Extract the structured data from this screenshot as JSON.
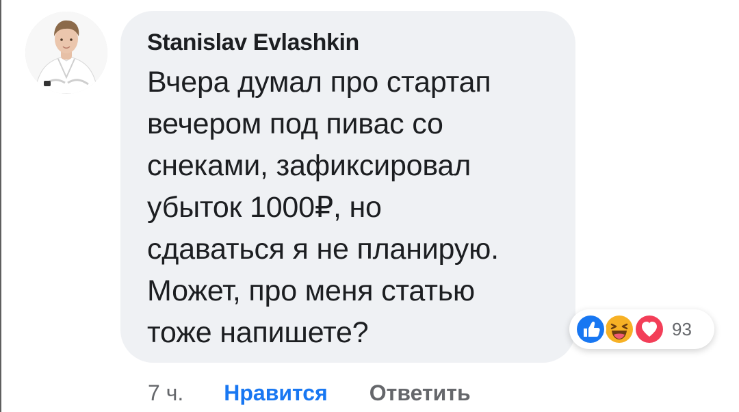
{
  "comment": {
    "author": "Stanislav Evlashkin",
    "text_lines": [
      "Вчера думал про стартап",
      "вечером под пивас со",
      "снеками, зафиксировал",
      "убыток 1000₽, но",
      "сдаваться я не планирую.",
      "Может, про меня статью",
      "тоже напишете?"
    ],
    "reactions": {
      "icons": [
        "like-icon",
        "haha-icon",
        "love-icon"
      ],
      "count": "93",
      "colors": {
        "like": "#1877f2",
        "haha": "#f7b125",
        "love": "#f33e58"
      }
    },
    "actions": {
      "time": "7 ч.",
      "like_label": "Нравится",
      "reply_label": "Ответить"
    }
  },
  "colors": {
    "bubble_bg": "#eff1f4",
    "text": "#1c1e21",
    "muted": "#65676b",
    "link": "#1877f2"
  }
}
